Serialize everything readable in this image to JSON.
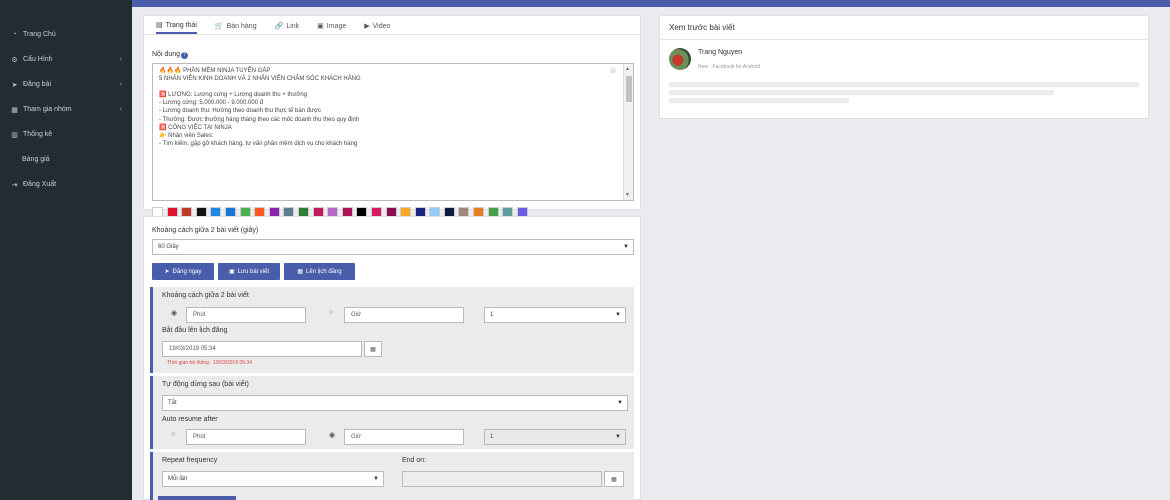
{
  "sidebar": {
    "items": [
      {
        "label": "Trang Chủ",
        "icon": "gauge-icon",
        "glyph": "◔",
        "has_children": false
      },
      {
        "label": "Cấu Hình",
        "icon": "gear-icon",
        "glyph": "⚙",
        "has_children": true
      },
      {
        "label": "Đăng bài",
        "icon": "paper-plane-icon",
        "glyph": "➤",
        "has_children": true
      },
      {
        "label": "Tham gia nhóm",
        "icon": "group-icon",
        "glyph": "▦",
        "has_children": true
      },
      {
        "label": "Thống kê",
        "icon": "chart-icon",
        "glyph": "▥",
        "has_children": false
      },
      {
        "label": "Bảng giá",
        "icon": "",
        "glyph": "",
        "has_children": false
      },
      {
        "label": "Đăng Xuất",
        "icon": "logout-icon",
        "glyph": "⇥",
        "has_children": false
      }
    ]
  },
  "tabs": [
    {
      "label": "Trạng thái",
      "glyph": "▤",
      "icon": "status-icon"
    },
    {
      "label": "Bán hàng",
      "glyph": "🛒",
      "icon": "cart-icon"
    },
    {
      "label": "Link",
      "glyph": "🔗",
      "icon": "link-icon"
    },
    {
      "label": "Image",
      "glyph": "▣",
      "icon": "image-icon"
    },
    {
      "label": "Video",
      "glyph": "▶",
      "icon": "video-icon"
    }
  ],
  "content": {
    "label": "Nội dung",
    "help_glyph": "?",
    "lines": [
      "🔥🔥🔥 PHẦN MỀM NINJA TUYỂN GẤP",
      "5 NHÂN VIÊN KINH DOANH VÀ 2 NHÂN VIÊN CHĂM SÓC KHÁCH HÀNG",
      "",
      "🈵 LƯƠNG: Lương cứng + Lương doanh thu + thưởng",
      "- Lương cứng: 5.000.000 - 9.000.000 đ",
      "- Lương doanh thu: Hưởng theo doanh thu thực tế bán được",
      "- Thưởng: Được thưởng hàng tháng theo các mốc doanh thu theo quy định",
      "🈵 CÔNG VIỆC TẠI NINJA",
      "👉 Nhân viên Sales:",
      "- Tìm kiếm, gặp gỡ khách hàng, tư vấn phần mềm dịch vụ cho khách hàng"
    ]
  },
  "swatches": [
    "#ffffff",
    "#e0102e",
    "#c0392b",
    "#111111",
    "#1e88e5",
    "#1976d2",
    "#4caf50",
    "#ff5722",
    "#8e24aa",
    "#607d8b",
    "#2e7d32",
    "#c2185b",
    "#ba68c8",
    "#ad1457",
    "#000000",
    "#d81b60",
    "#880e4f",
    "#f9a825",
    "#1a237e",
    "#90caf9",
    "#0d1b3e",
    "#a1887f",
    "#e67e22",
    "#43a047",
    "#5f9ea0",
    "#6c5ce7"
  ],
  "schedule": {
    "interval_label": "Khoảng cách giữa 2 bài viết (giây)",
    "interval_value": "60 Giây",
    "buttons": {
      "post_now": "Đăng ngay",
      "save": "Lưu bài viết",
      "schedule": "Lên lịch đăng"
    },
    "sect1": {
      "title": "Khoảng cách giữa 2 bài viết",
      "minute": "Phút",
      "hour": "Giờ",
      "count": "1",
      "start_label": "Bắt đầu lên lịch đăng",
      "start_value": "19/03/2019 05:34",
      "system_time": "Thời gian hệ thống : 19/03/2019 05:34"
    },
    "sect2": {
      "title": "Tự động dừng sau (bài viết)",
      "value": "Tắt",
      "resume_label": "Auto resume after",
      "minute": "Phút",
      "hour": "Giờ",
      "count": "1"
    },
    "sect3": {
      "repeat_label": "Repeat frequency",
      "repeat_value": "Mỗi lần",
      "end_label": "End on:",
      "end_value": ""
    }
  },
  "preview": {
    "title": "Xem trước bài viết",
    "user": "Trang Nguyen",
    "meta": "Now · Facebook for Android"
  }
}
